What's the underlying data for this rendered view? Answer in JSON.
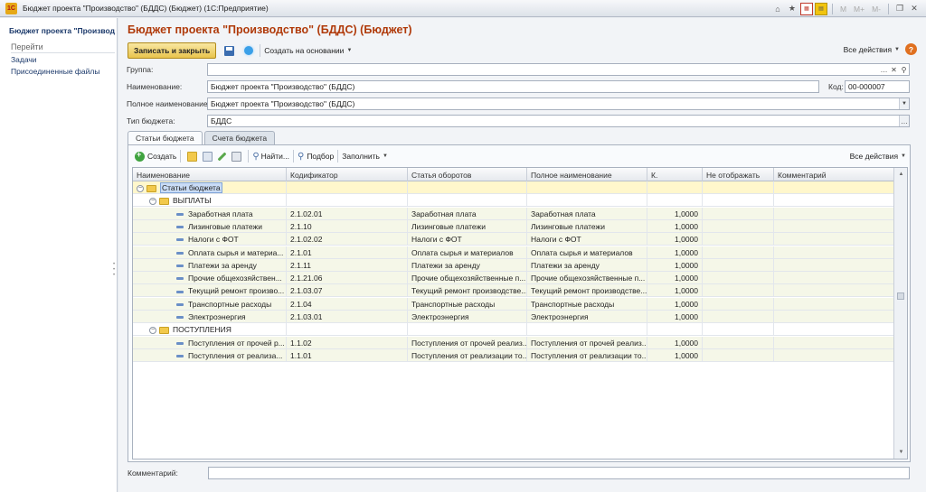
{
  "window": {
    "title": "Бюджет проекта \"Производство\" (БДДС) (Бюджет)  (1С:Предприятие)",
    "logo": "1С",
    "m_labels": [
      "M",
      "M+",
      "M-"
    ]
  },
  "sidebar": {
    "title": "Бюджет проекта \"Производство\"",
    "goto": "Перейти",
    "items": [
      {
        "label": "Задачи"
      },
      {
        "label": "Присоединенные файлы"
      }
    ]
  },
  "form": {
    "title": "Бюджет проекта \"Производство\" (БДДС) (Бюджет)",
    "toolbar": {
      "save_close": "Записать и закрыть",
      "create_based": "Создать на основании",
      "all_actions": "Все действия",
      "help": "?"
    },
    "fields": {
      "group_label": "Группа:",
      "group_value": "",
      "name_label": "Наименование:",
      "name_value": "Бюджет проекта \"Производство\" (БДДС)",
      "code_label": "Код:",
      "code_value": "00-000007",
      "fullname_label": "Полное наименование:",
      "fullname_value": "Бюджет проекта \"Производство\" (БДДС)",
      "type_label": "Тип бюджета:",
      "type_value": "БДДС"
    },
    "tabs": [
      {
        "label": "Статьи бюджета",
        "active": true
      },
      {
        "label": "Счета бюджета",
        "active": false
      }
    ],
    "subtoolbar": {
      "create": "Создать",
      "find": "Найти...",
      "select": "Подбор",
      "fill": "Заполнить",
      "all_actions": "Все действия"
    },
    "table": {
      "columns": [
        "Наименование",
        "Кодификатор",
        "Статья оборотов",
        "Полное наименование",
        "К.",
        "Не отображать",
        "Комментарий"
      ],
      "rows": [
        {
          "kind": "root",
          "name": "Статьи бюджета",
          "code": "",
          "turnover": "",
          "full": "",
          "k": "",
          "hide": "",
          "comment": ""
        },
        {
          "kind": "group",
          "name": "ВЫПЛАТЫ",
          "code": "",
          "turnover": "",
          "full": "",
          "k": "",
          "hide": "",
          "comment": ""
        },
        {
          "kind": "item",
          "name": "Заработная плата",
          "code": "2.1.02.01",
          "turnover": "Заработная плата",
          "full": "Заработная плата",
          "k": "1,0000",
          "hide": "",
          "comment": ""
        },
        {
          "kind": "item",
          "name": "Лизинговые платежи",
          "code": "2.1.10",
          "turnover": "Лизинговые платежи",
          "full": "Лизинговые платежи",
          "k": "1,0000",
          "hide": "",
          "comment": ""
        },
        {
          "kind": "item",
          "name": "Налоги с ФОТ",
          "code": "2.1.02.02",
          "turnover": "Налоги с ФОТ",
          "full": "Налоги с ФОТ",
          "k": "1,0000",
          "hide": "",
          "comment": ""
        },
        {
          "kind": "item",
          "name": "Оплата сырья и материа...",
          "code": "2.1.01",
          "turnover": "Оплата сырья и материалов",
          "full": "Оплата сырья и материалов",
          "k": "1,0000",
          "hide": "",
          "comment": ""
        },
        {
          "kind": "item",
          "name": "Платежи за аренду",
          "code": "2.1.11",
          "turnover": "Платежи за аренду",
          "full": "Платежи за аренду",
          "k": "1,0000",
          "hide": "",
          "comment": ""
        },
        {
          "kind": "item",
          "name": "Прочие общехозяйствен...",
          "code": "2.1.21.06",
          "turnover": "Прочие общехозяйственные п...",
          "full": "Прочие общехозяйственные п...",
          "k": "1,0000",
          "hide": "",
          "comment": ""
        },
        {
          "kind": "item",
          "name": "Текущий ремонт произво...",
          "code": "2.1.03.07",
          "turnover": "Текущий ремонт производстве...",
          "full": "Текущий ремонт производстве...",
          "k": "1,0000",
          "hide": "",
          "comment": ""
        },
        {
          "kind": "item",
          "name": "Транспортные расходы",
          "code": "2.1.04",
          "turnover": "Транспортные расходы",
          "full": "Транспортные расходы",
          "k": "1,0000",
          "hide": "",
          "comment": ""
        },
        {
          "kind": "item",
          "name": "Электроэнергия",
          "code": "2.1.03.01",
          "turnover": "Электроэнергия",
          "full": "Электроэнергия",
          "k": "1,0000",
          "hide": "",
          "comment": ""
        },
        {
          "kind": "group",
          "name": "ПОСТУПЛЕНИЯ",
          "code": "",
          "turnover": "",
          "full": "",
          "k": "",
          "hide": "",
          "comment": ""
        },
        {
          "kind": "item",
          "name": "Поступления от прочей р...",
          "code": "1.1.02",
          "turnover": "Поступления от прочей реализ...",
          "full": "Поступления от прочей реализ...",
          "k": "1,0000",
          "hide": "",
          "comment": ""
        },
        {
          "kind": "item",
          "name": "Поступления от реализа...",
          "code": "1.1.01",
          "turnover": "Поступления от реализации то...",
          "full": "Поступления от реализации то...",
          "k": "1,0000",
          "hide": "",
          "comment": ""
        }
      ]
    },
    "comment_label": "Комментарий:",
    "comment_value": ""
  }
}
